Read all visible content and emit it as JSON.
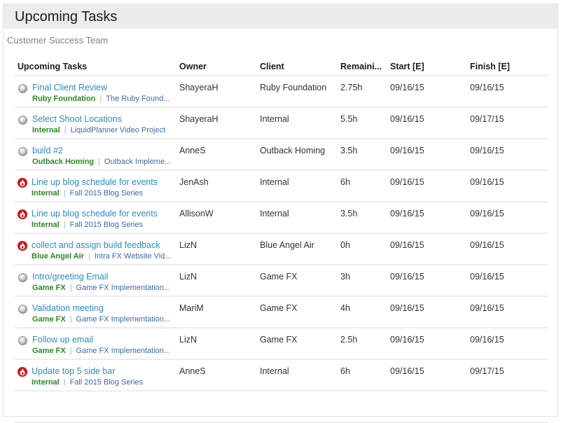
{
  "panel": {
    "title": "Upcoming Tasks",
    "subtitle": "Customer Success Team"
  },
  "table": {
    "headers": {
      "task": "Upcoming Tasks",
      "owner": "Owner",
      "client": "Client",
      "remaining": "Remaini...",
      "start": "Start [E]",
      "finish": "Finish [E]"
    },
    "rows": [
      {
        "status_icon": "normal-status-icon",
        "name": "Final Client Review",
        "meta_client": "Ruby Foundation",
        "meta_project": "The Ruby Found...",
        "owner": "ShayeraH",
        "client": "Ruby Foundation",
        "remaining": "2.75h",
        "start": "09/16/15",
        "finish": "09/16/15"
      },
      {
        "status_icon": "normal-status-icon",
        "name": "Select Shoot Locations",
        "meta_client": "Internal",
        "meta_project": "LiquidPlanner Video Project",
        "owner": "ShayeraH",
        "client": "Internal",
        "remaining": "5.5h",
        "start": "09/16/15",
        "finish": "09/17/15"
      },
      {
        "status_icon": "normal-status-icon",
        "name": "build #2",
        "meta_client": "Outback Homing",
        "meta_project": "Outback Impleme...",
        "owner": "AnneS",
        "client": "Outback Homing",
        "remaining": "3.5h",
        "start": "09/16/15",
        "finish": "09/16/15"
      },
      {
        "status_icon": "urgent-fire-icon",
        "name": "Line up blog schedule for events",
        "meta_client": "Internal",
        "meta_project": "Fall 2015 Blog Series",
        "owner": "JenAsh",
        "client": "Internal",
        "remaining": "6h",
        "start": "09/16/15",
        "finish": "09/16/15"
      },
      {
        "status_icon": "urgent-fire-icon",
        "name": "Line up blog schedule for events",
        "meta_client": "Internal",
        "meta_project": "Fall 2015 Blog Series",
        "owner": "AllisonW",
        "client": "Internal",
        "remaining": "3.5h",
        "start": "09/16/15",
        "finish": "09/16/15"
      },
      {
        "status_icon": "urgent-fire-icon",
        "name": "collect and assign build feedback",
        "meta_client": "Blue Angel Air",
        "meta_project": "Intra FX Website Vid...",
        "owner": "LizN",
        "client": "Blue Angel Air",
        "remaining": "0h",
        "start": "09/16/15",
        "finish": "09/16/15"
      },
      {
        "status_icon": "normal-status-icon",
        "name": "Intro/greeting Email",
        "meta_client": "Game FX",
        "meta_project": "Game FX Implementation...",
        "owner": "LizN",
        "client": "Game FX",
        "remaining": "3h",
        "start": "09/16/15",
        "finish": "09/16/15"
      },
      {
        "status_icon": "normal-status-icon",
        "name": "Validation meeting",
        "meta_client": "Game FX",
        "meta_project": "Game FX Implementation...",
        "owner": "MariM",
        "client": "Game FX",
        "remaining": "4h",
        "start": "09/16/15",
        "finish": "09/16/15"
      },
      {
        "status_icon": "normal-status-icon",
        "name": "Follow up email",
        "meta_client": "Game FX",
        "meta_project": "Game FX Implementation...",
        "owner": "LizN",
        "client": "Game FX",
        "remaining": "2.5h",
        "start": "09/16/15",
        "finish": "09/16/15"
      },
      {
        "status_icon": "urgent-fire-icon",
        "name": "Update top 5 side bar",
        "meta_client": "Internal",
        "meta_project": "Fall 2015 Blog Series",
        "owner": "AnneS",
        "client": "Internal",
        "remaining": "6h",
        "start": "09/16/15",
        "finish": "09/17/15"
      }
    ],
    "separator": "|"
  },
  "colors": {
    "task_link": "#2a8ccc",
    "client_green": "#2a8a22",
    "project_link": "#3c6aa8",
    "urgent_red": "#d0141c",
    "header_bg": "#ececec"
  }
}
